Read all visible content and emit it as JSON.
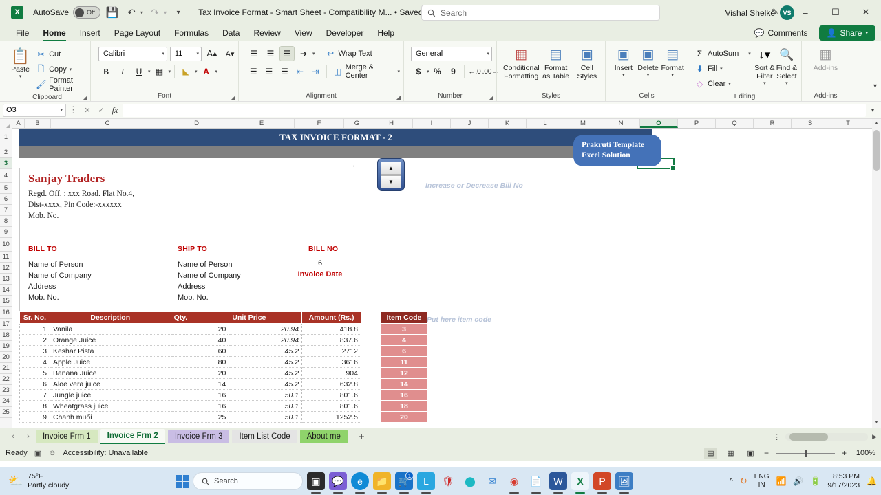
{
  "titlebar": {
    "app_icon": "excel-icon",
    "autosave_label": "AutoSave",
    "autosave_state": "Off",
    "document_title": "Tax Invoice Format - Smart Sheet  -  Compatibility M...  • Saved to this PC",
    "search_placeholder": "Search",
    "user_name": "Vishal Shelke",
    "user_initials": "VS"
  },
  "menubar": {
    "items": [
      "File",
      "Home",
      "Insert",
      "Page Layout",
      "Formulas",
      "Data",
      "Review",
      "View",
      "Developer",
      "Help"
    ],
    "active": "Home",
    "comments_label": "Comments",
    "share_label": "Share"
  },
  "ribbon": {
    "clipboard": {
      "group_label": "Clipboard",
      "paste_label": "Paste",
      "cut_label": "Cut",
      "copy_label": "Copy",
      "format_painter_label": "Format Painter"
    },
    "font": {
      "group_label": "Font",
      "font_name": "Calibri",
      "font_size": "11",
      "grow_label": "A",
      "shrink_label": "A",
      "bold": "B",
      "italic": "I",
      "underline": "U"
    },
    "alignment": {
      "group_label": "Alignment",
      "wrap_text_label": "Wrap Text",
      "merge_center_label": "Merge & Center"
    },
    "number": {
      "group_label": "Number",
      "format": "General",
      "currency": "$",
      "percent": "%",
      "comma": "9"
    },
    "styles": {
      "group_label": "Styles",
      "conditional_formatting_label": "Conditional Formatting",
      "format_as_table_label": "Format as Table",
      "cell_styles_label": "Cell Styles"
    },
    "cells": {
      "group_label": "Cells",
      "insert_label": "Insert",
      "delete_label": "Delete",
      "format_label": "Format"
    },
    "editing": {
      "group_label": "Editing",
      "autosum_label": "AutoSum",
      "fill_label": "Fill",
      "clear_label": "Clear",
      "sort_filter_label": "Sort & Filter",
      "find_select_label": "Find & Select"
    },
    "addins": {
      "group_label": "Add-ins",
      "addins_label": "Add-ins"
    }
  },
  "formulabar": {
    "name_box": "O3",
    "formula_value": ""
  },
  "grid": {
    "columns": [
      "A",
      "B",
      "C",
      "D",
      "E",
      "F",
      "G",
      "H",
      "I",
      "J",
      "K",
      "L",
      "M",
      "N",
      "O",
      "P",
      "Q",
      "R",
      "S",
      "T"
    ],
    "selected_column": "O",
    "rows": [
      "1",
      "2",
      "3",
      "4",
      "5",
      "6",
      "7",
      "8",
      "9",
      "10",
      "11",
      "12",
      "13",
      "14",
      "15",
      "16",
      "17",
      "18",
      "19",
      "20",
      "21",
      "22",
      "23",
      "24",
      "25"
    ],
    "selected_row": "3"
  },
  "sheet": {
    "banner_title": "TAX INVOICE FORMAT - 2",
    "watermark_line1": "Prakruti Template",
    "watermark_line2": "Excel Solution",
    "company_name": "Sanjay Traders",
    "company_address_1": "Regd. Off. : xxx Road. Flat No.4,",
    "company_address_2": "Dist-xxxx, Pin Code:-xxxxxx",
    "company_mobile": "Mob. No.",
    "bill_to_label": "BILL TO",
    "ship_to_label": "SHIP TO",
    "bill_no_label": "BILL NO",
    "bill_to": [
      "Name of Person",
      "Name of Company",
      "Address",
      "Mob. No."
    ],
    "ship_to": [
      "Name of Person",
      "Name of Company",
      "Address",
      "Mob. No."
    ],
    "bill_no_value": "6",
    "invoice_date_label": "Invoice Date",
    "spinner_hint": "Increase or Decrease Bill No",
    "item_code_hint": "Put here item code",
    "item_code_header": "Item Code",
    "item_codes": [
      "3",
      "4",
      "6",
      "11",
      "12",
      "14",
      "16",
      "18",
      "20"
    ],
    "table_headers": [
      "Sr. No.",
      "Description",
      "Qty.",
      "Unit Price",
      "Amount (Rs.)"
    ],
    "table_rows": [
      {
        "sr": "1",
        "desc": "Vanila",
        "qty": "20",
        "price": "20.94",
        "amount": "418.8"
      },
      {
        "sr": "2",
        "desc": "Orange Juice",
        "qty": "40",
        "price": "20.94",
        "amount": "837.6"
      },
      {
        "sr": "3",
        "desc": "Keshar Pista",
        "qty": "60",
        "price": "45.2",
        "amount": "2712"
      },
      {
        "sr": "4",
        "desc": "Apple Juice",
        "qty": "80",
        "price": "45.2",
        "amount": "3616"
      },
      {
        "sr": "5",
        "desc": "Banana Juice",
        "qty": "20",
        "price": "45.2",
        "amount": "904"
      },
      {
        "sr": "6",
        "desc": "Aloe vera juice",
        "qty": "14",
        "price": "45.2",
        "amount": "632.8"
      },
      {
        "sr": "7",
        "desc": "Jungle juice",
        "qty": "16",
        "price": "50.1",
        "amount": "801.6"
      },
      {
        "sr": "8",
        "desc": "Wheatgrass juice",
        "qty": "16",
        "price": "50.1",
        "amount": "801.6"
      },
      {
        "sr": "9",
        "desc": "Chanh muối",
        "qty": "25",
        "price": "50.1",
        "amount": "1252.5"
      }
    ]
  },
  "sheettabs": {
    "tabs": [
      {
        "label": "Invoice Frm 1",
        "color": "#d6e8c0",
        "active": false
      },
      {
        "label": "Invoice Frm 2",
        "color": "#f7f9f4",
        "active": true
      },
      {
        "label": "Invoice Frm 3",
        "color": "#c9bde4",
        "active": false
      },
      {
        "label": "Item List Code",
        "color": "#e4e4e4",
        "active": false
      },
      {
        "label": "About me",
        "color": "#8fd36b",
        "active": false
      }
    ],
    "add_sheet_label": "+"
  },
  "statusbar": {
    "status": "Ready",
    "accessibility": "Accessibility: Unavailable",
    "zoom": "100%"
  },
  "taskbar": {
    "weather_temp": "75°F",
    "weather_desc": "Partly cloudy",
    "search_placeholder": "Search",
    "language": "ENG",
    "region": "IN",
    "time": "8:53 PM",
    "date": "9/17/2023",
    "store_badge": "1"
  }
}
